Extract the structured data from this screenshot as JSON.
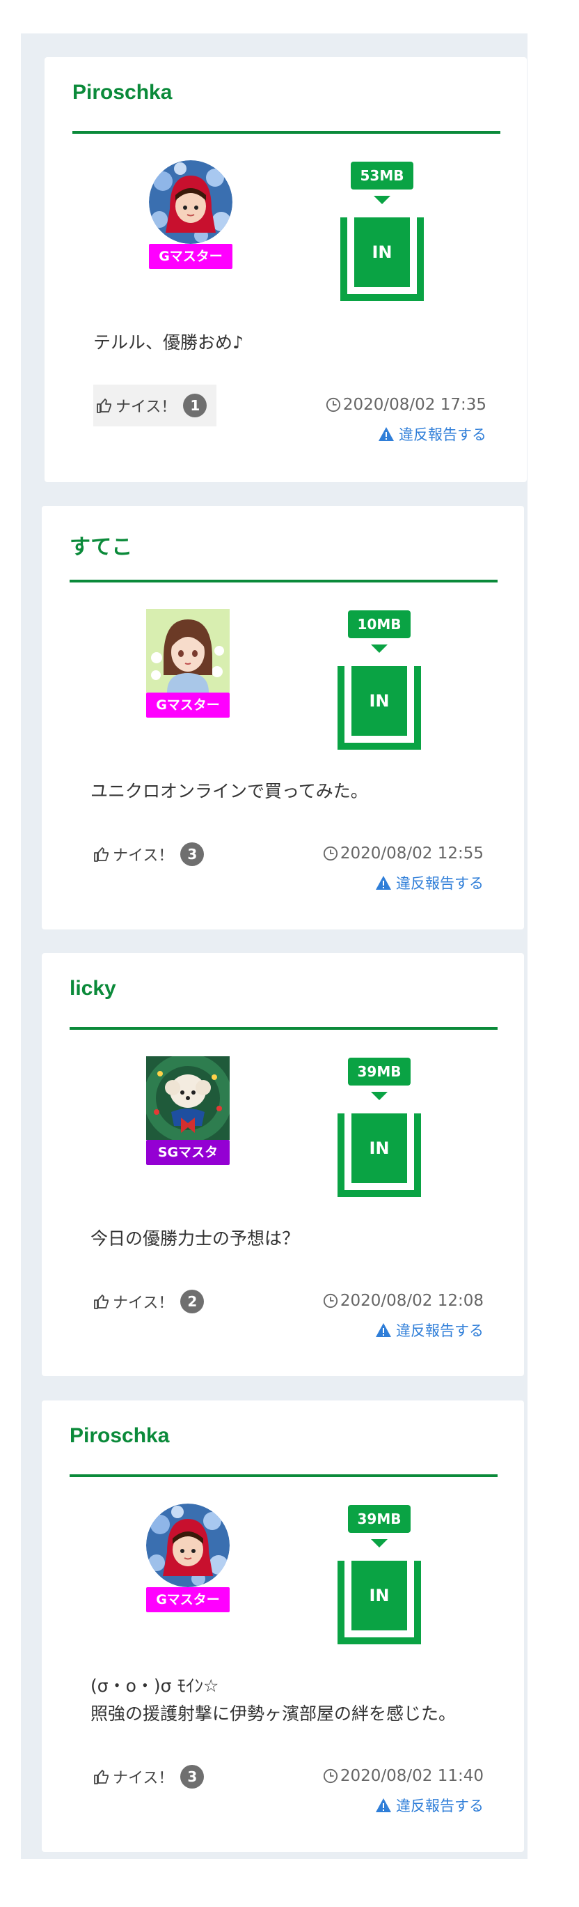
{
  "posts": [
    {
      "user": "Piroschka",
      "rank": "Gマスター",
      "rank_color": "#ff00ff",
      "avatar": "red-hood-girl-avatar",
      "size": "53MB",
      "status": "IN",
      "message": "テルル、優勝おめ♪",
      "message_line2": "",
      "nice_label": "ナイス！",
      "nice_count": "1",
      "timestamp": "2020/08/02 17:35",
      "report_label": "違反報告する"
    },
    {
      "user": "すてこ",
      "rank": "Gマスター",
      "rank_color": "#ff00ff",
      "avatar": "anime-girl-avatar",
      "size": "10MB",
      "status": "IN",
      "message": "ユニクロオンラインで買ってみた。",
      "message_line2": "",
      "nice_label": "ナイス！",
      "nice_count": "3",
      "timestamp": "2020/08/02 12:55",
      "report_label": "違反報告する"
    },
    {
      "user": "licky",
      "rank": "SGマスタ",
      "rank_color": "#9400d3",
      "avatar": "poodle-wreath-avatar",
      "size": "39MB",
      "status": "IN",
      "message": "今日の優勝力士の予想は？",
      "message_line2": "",
      "nice_label": "ナイス！",
      "nice_count": "2",
      "timestamp": "2020/08/02 12:08",
      "report_label": "違反報告する"
    },
    {
      "user": "Piroschka",
      "rank": "Gマスター",
      "rank_color": "#ff00ff",
      "avatar": "red-hood-girl-avatar",
      "size": "39MB",
      "status": "IN",
      "message": "(σ・o・)σ ﾓｲﾝ☆",
      "message_line2": "照強の援護射撃に伊勢ヶ濱部屋の絆を感じた。",
      "nice_label": "ナイス！",
      "nice_count": "3",
      "timestamp": "2020/08/02 11:40",
      "report_label": "違反報告する"
    }
  ],
  "colors": {
    "accent_green": "#0b8a3a",
    "badge_green": "#0aa344",
    "link_blue": "#2f7ed8",
    "panel_bg": "#e9eef3"
  }
}
